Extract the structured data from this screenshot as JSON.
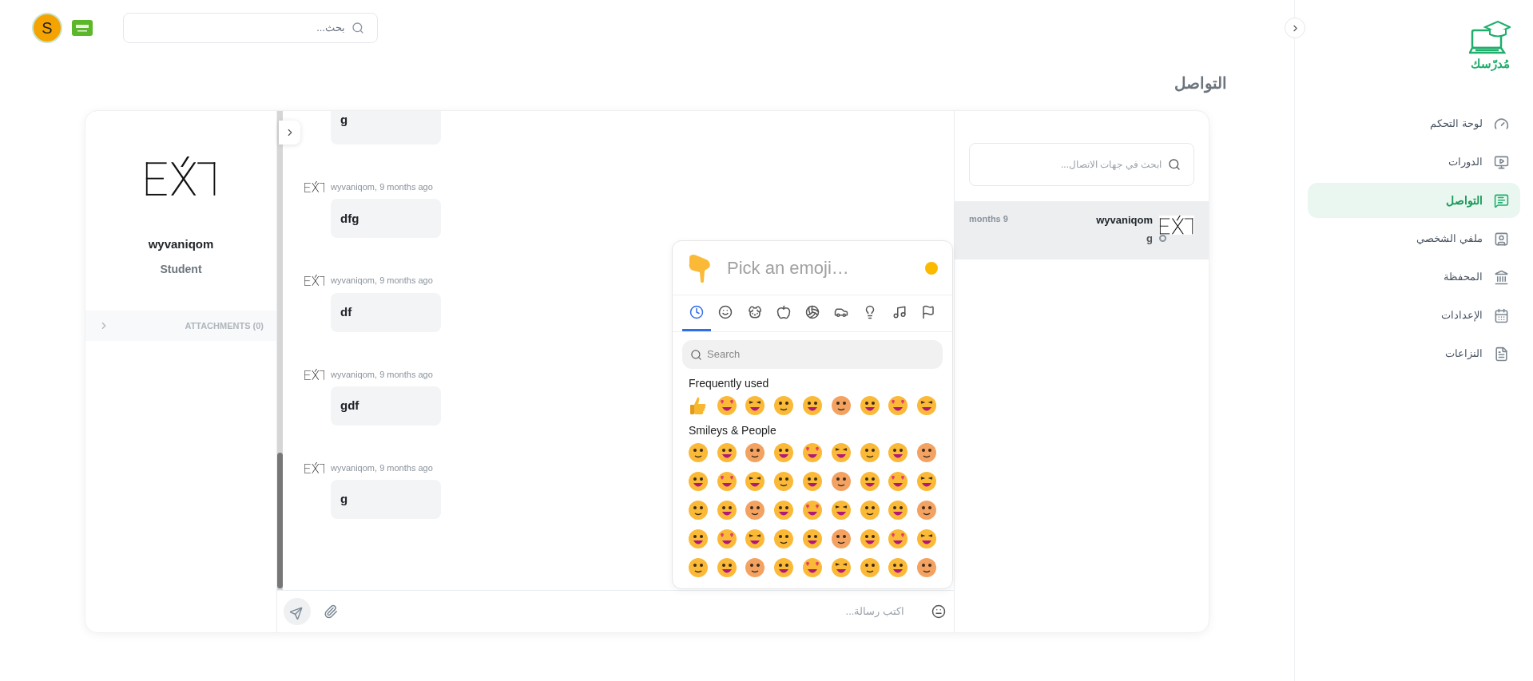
{
  "top_bar": {
    "avatar_letter": "S",
    "search": {
      "placeholder": "بحث..."
    }
  },
  "sidebar": {
    "logo_text": "مُدرّسك",
    "items": [
      {
        "kind": "dashboard",
        "label": "لوحة التحكم",
        "selected": false
      },
      {
        "kind": "courses",
        "label": "الدورات",
        "selected": false
      },
      {
        "kind": "chat",
        "label": "التواصل",
        "selected": true
      },
      {
        "kind": "profile",
        "label": "ملفي الشخصي",
        "selected": false
      },
      {
        "kind": "wallet",
        "label": "المحفظة",
        "selected": false
      },
      {
        "kind": "settings",
        "label": "الإعدادات",
        "selected": false
      },
      {
        "kind": "disputes",
        "label": "النزاعات",
        "selected": false
      }
    ]
  },
  "page_title": "التواصل",
  "profile": {
    "name": "wyvaniqom",
    "role": "Student",
    "attachments_label": "ATTACHMENTS (0)"
  },
  "chat": {
    "messages": [
      {
        "text": "g"
      },
      {
        "meta": "wyvaniqom, 9 months ago",
        "text": "dfg"
      },
      {
        "meta": "wyvaniqom, 9 months ago",
        "text": "df"
      },
      {
        "meta": "wyvaniqom, 9 months ago",
        "text": "gdf"
      },
      {
        "meta": "wyvaniqom, 9 months ago",
        "text": "g"
      }
    ],
    "composer": {
      "placeholder": "اكتب رسالة..."
    }
  },
  "emoji_picker": {
    "preview_text": "Pick an emoji…",
    "search_placeholder": "Search",
    "categories": [
      {
        "kind": "recent",
        "selected": true
      },
      {
        "kind": "smileys",
        "selected": false
      },
      {
        "kind": "animals",
        "selected": false
      },
      {
        "kind": "food",
        "selected": false
      },
      {
        "kind": "activity",
        "selected": false
      },
      {
        "kind": "travel",
        "selected": false
      },
      {
        "kind": "objects",
        "selected": false
      },
      {
        "kind": "symbols",
        "selected": false
      },
      {
        "kind": "flags",
        "selected": false
      }
    ],
    "sections": [
      {
        "title": "Frequently used"
      },
      {
        "title": "Smileys & People"
      }
    ]
  },
  "contacts": {
    "search": {
      "placeholder": "ابحث في جهات الاتصال..."
    },
    "items": [
      {
        "name": "wyvaniqom",
        "last_message": "g",
        "time": "months 9",
        "selected": true,
        "online": false
      }
    ]
  }
}
